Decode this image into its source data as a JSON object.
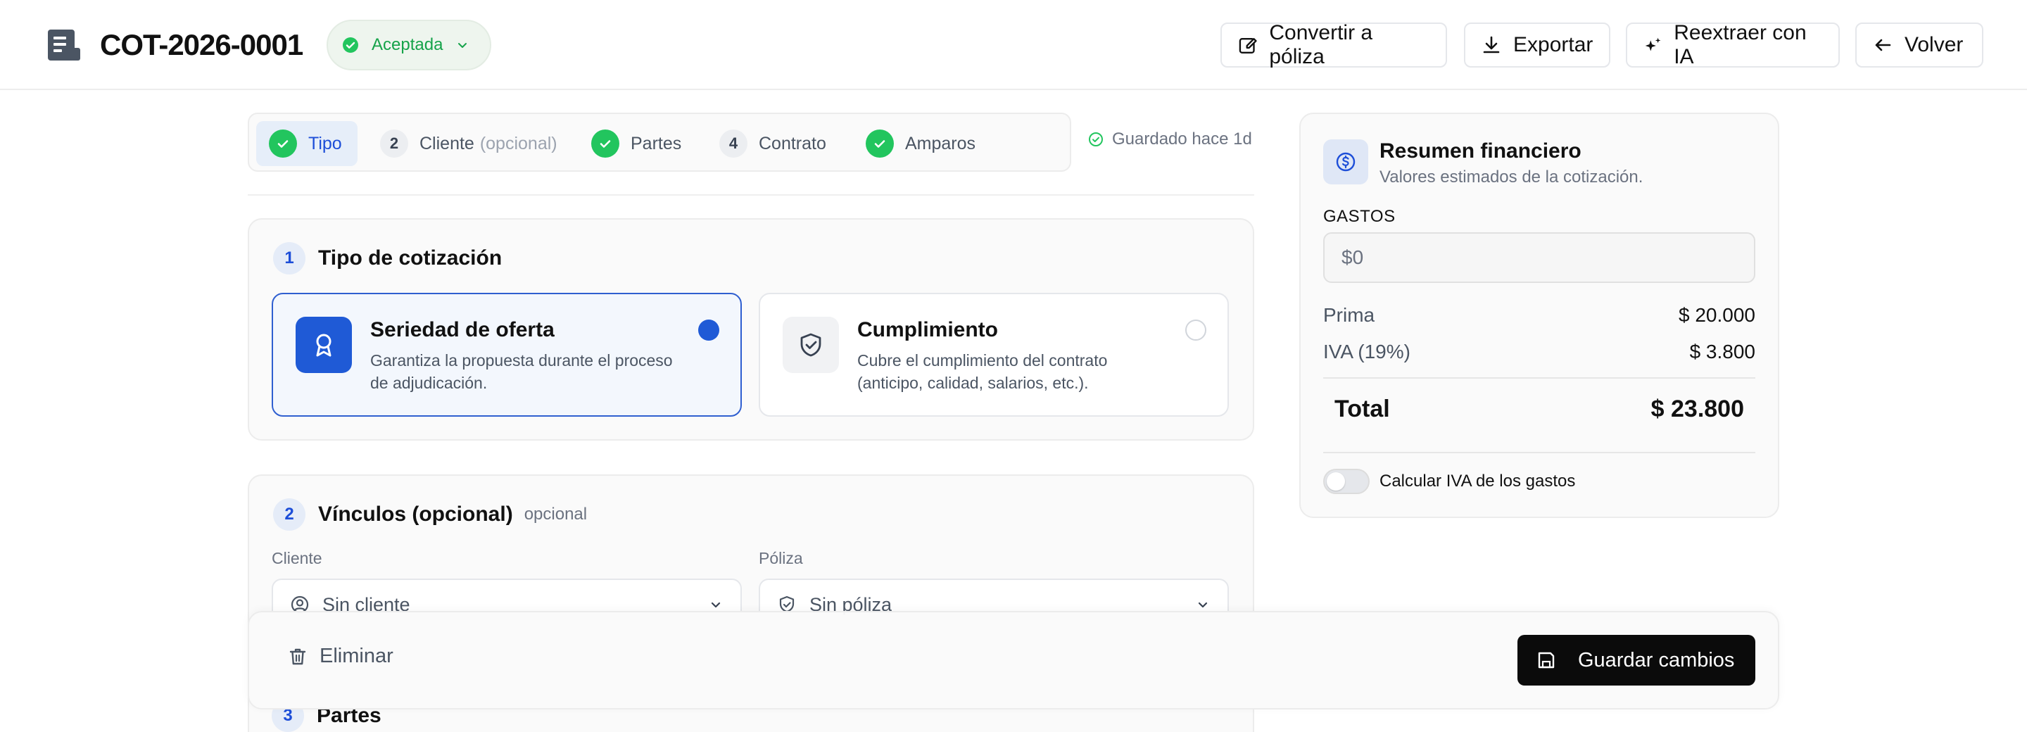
{
  "header": {
    "title": "COT-2026-0001",
    "status": "Aceptada",
    "buttons": {
      "convert": "Convertir a póliza",
      "export": "Exportar",
      "reextract": "Reextraer con IA",
      "back": "Volver"
    }
  },
  "stepper": {
    "steps": [
      {
        "label": "Tipo",
        "state": "active-done"
      },
      {
        "num": "2",
        "label": "Cliente",
        "suffix": "(opcional)"
      },
      {
        "label": "Partes",
        "state": "done"
      },
      {
        "num": "4",
        "label": "Contrato"
      },
      {
        "label": "Amparos",
        "state": "done"
      }
    ],
    "saved": "Guardado hace 1d"
  },
  "section1": {
    "num": "1",
    "title": "Tipo de cotización",
    "options": [
      {
        "title": "Seriedad de oferta",
        "desc": "Garantiza la propuesta durante el proceso de adjudicación.",
        "selected": true
      },
      {
        "title": "Cumplimiento",
        "desc": "Cubre el cumplimiento del contrato (anticipo, calidad, salarios, etc.).",
        "selected": false
      }
    ]
  },
  "section2": {
    "num": "2",
    "title": "Vínculos (opcional)",
    "subtitle": "opcional",
    "cliente_label": "Cliente",
    "cliente_value": "Sin cliente",
    "poliza_label": "Póliza",
    "poliza_value": "Sin póliza"
  },
  "section3": {
    "num": "3",
    "title": "Partes"
  },
  "financial": {
    "title": "Resumen financiero",
    "subtitle": "Valores estimados de la cotización.",
    "gastos_label": "GASTOS",
    "gastos_placeholder": "$0",
    "rows": [
      {
        "k": "Prima",
        "v": "$ 20.000"
      },
      {
        "k": "IVA (19%)",
        "v": "$ 3.800"
      }
    ],
    "total_label": "Total",
    "total_value": "$ 23.800",
    "toggle_label": "Calcular IVA de los gastos",
    "toggle_on": false
  },
  "actions": {
    "delete": "Eliminar",
    "save": "Guardar cambios"
  },
  "colors": {
    "accent": "#1f5ad6",
    "success": "#22c55e",
    "primary_button": "#0b0b0b"
  }
}
